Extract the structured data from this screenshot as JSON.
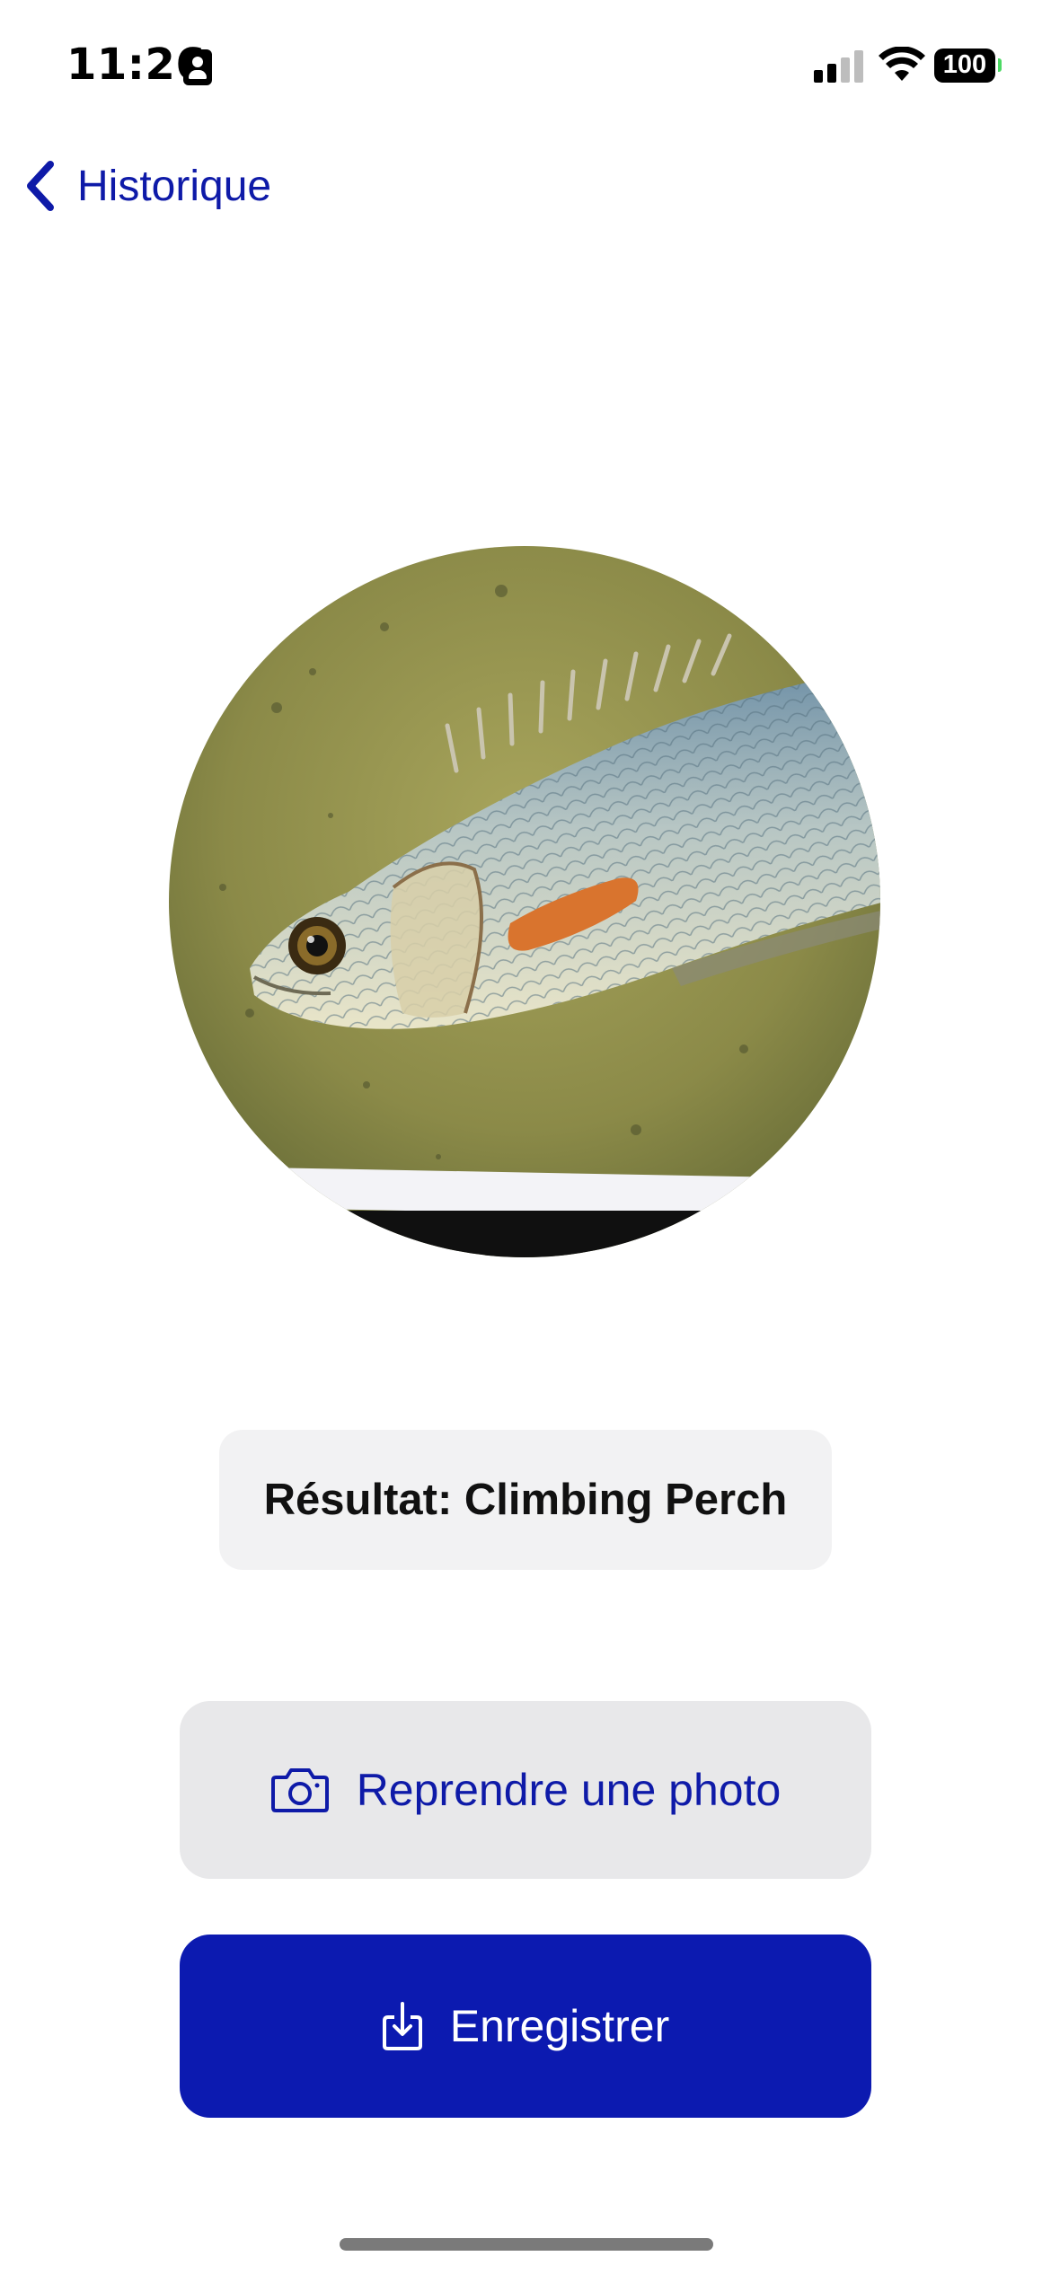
{
  "status_bar": {
    "time": "11:26",
    "battery": "100",
    "icons": [
      "contact-card-icon",
      "cellular-signal-icon",
      "wifi-icon",
      "battery-icon"
    ]
  },
  "nav": {
    "back_label": "Historique",
    "back_icon": "chevron-left-icon"
  },
  "photo": {
    "subject": "fish-photo"
  },
  "result": {
    "text": "Résultat: Climbing Perch"
  },
  "actions": {
    "retake_label": "Reprendre une photo",
    "retake_icon": "camera-icon",
    "save_label": "Enregistrer",
    "save_icon": "download-tray-icon"
  },
  "colors": {
    "accent": "#0e1aa8",
    "primary_button": "#0c1ab0",
    "secondary_button": "#e8e8ea",
    "result_bg": "#f2f2f3"
  }
}
